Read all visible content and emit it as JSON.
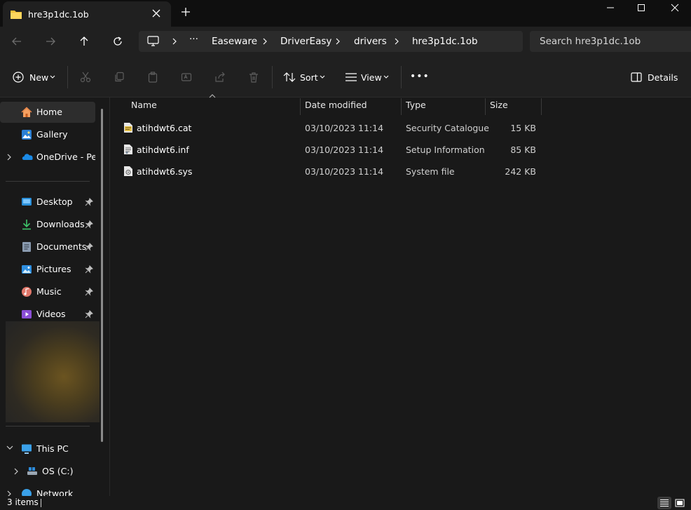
{
  "window": {
    "tab_title": "hre3p1dc.1ob",
    "new_tab_label": "+"
  },
  "address": {
    "more_label": "···",
    "breadcrumbs": [
      "Easeware",
      "DriverEasy",
      "drivers",
      "hre3p1dc.1ob"
    ],
    "search_placeholder": "Search hre3p1dc.1ob"
  },
  "toolbar": {
    "new_label": "New",
    "sort_label": "Sort",
    "view_label": "View",
    "more_label": "•••",
    "details_label": "Details"
  },
  "sidebar": {
    "top_items": [
      {
        "label": "Home",
        "icon": "home-icon"
      },
      {
        "label": "Gallery",
        "icon": "gallery-icon"
      },
      {
        "label": "OneDrive - Personal",
        "icon": "onedrive-icon"
      }
    ],
    "quick_access": [
      {
        "label": "Desktop",
        "icon": "desktop-folder-icon"
      },
      {
        "label": "Downloads",
        "icon": "downloads-folder-icon"
      },
      {
        "label": "Documents",
        "icon": "documents-folder-icon"
      },
      {
        "label": "Pictures",
        "icon": "pictures-folder-icon"
      },
      {
        "label": "Music",
        "icon": "music-folder-icon"
      },
      {
        "label": "Videos",
        "icon": "videos-folder-icon"
      }
    ],
    "this_pc_label": "This PC",
    "drive_label": "OS (C:)",
    "network_label": "Network"
  },
  "columns": {
    "name": "Name",
    "date_modified": "Date modified",
    "type": "Type",
    "size": "Size"
  },
  "files": [
    {
      "name": "atihdwt6.cat",
      "date": "03/10/2023 11:14",
      "type": "Security Catalogue",
      "size": "15 KB",
      "icon": "catalog-file-icon"
    },
    {
      "name": "atihdwt6.inf",
      "date": "03/10/2023 11:14",
      "type": "Setup Information",
      "size": "85 KB",
      "icon": "inf-file-icon"
    },
    {
      "name": "atihdwt6.sys",
      "date": "03/10/2023 11:14",
      "type": "System file",
      "size": "242 KB",
      "icon": "sys-file-icon"
    }
  ],
  "status": {
    "item_count": "3 items"
  },
  "colors": {
    "accent": "#4cc2ff",
    "folder_yellow": "#f3c13a",
    "background": "#191919"
  }
}
